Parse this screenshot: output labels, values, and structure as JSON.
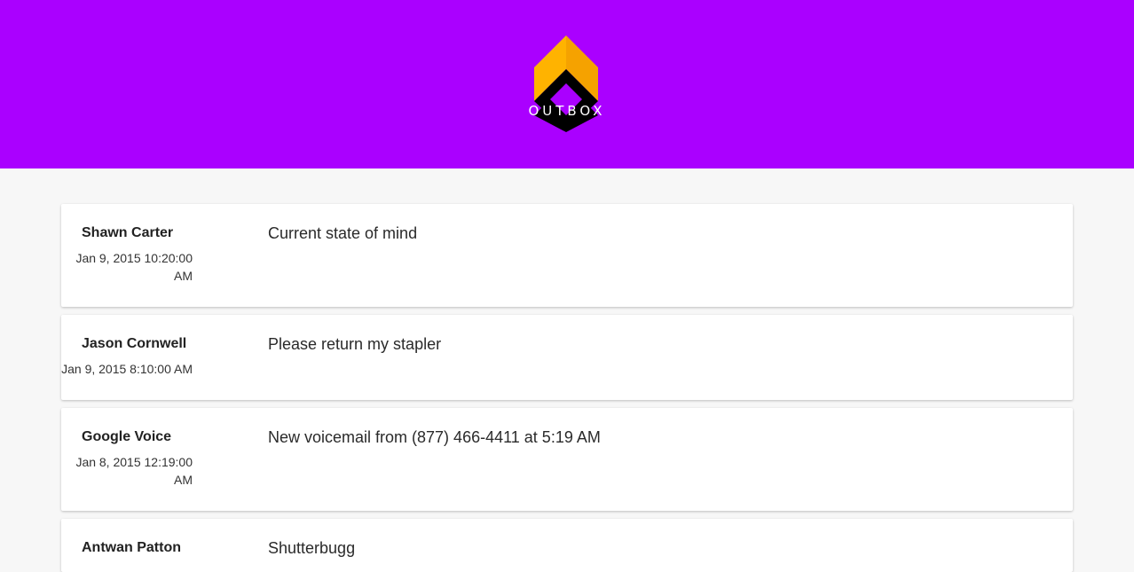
{
  "app": {
    "logo_text": "OUTBOX",
    "brand_color": "#aa00ff",
    "logo_colors": {
      "top": "#ffb300",
      "bottom": "#000000"
    }
  },
  "messages": [
    {
      "sender": "Shawn Carter",
      "date": "Jan 9, 2015 10:20:00 AM",
      "subject": "Current state of mind"
    },
    {
      "sender": "Jason Cornwell",
      "date": "Jan 9, 2015 8:10:00 AM",
      "subject": "Please return my stapler"
    },
    {
      "sender": "Google Voice",
      "date": "Jan 8, 2015 12:19:00 AM",
      "subject": "New voicemail from (877) 466-4411 at 5:19 AM"
    },
    {
      "sender": "Antwan Patton",
      "date": "",
      "subject": "Shutterbugg"
    }
  ]
}
